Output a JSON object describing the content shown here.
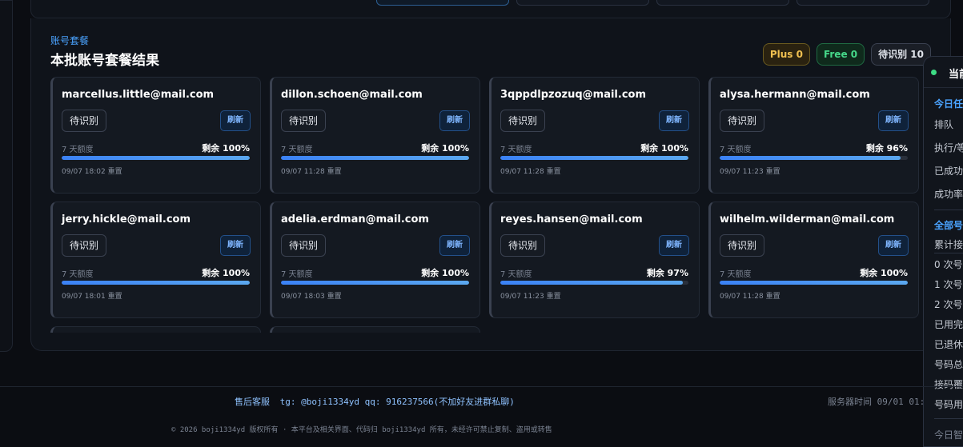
{
  "section": {
    "label": "账号套餐",
    "title": "本批账号套餐结果"
  },
  "chips": [
    {
      "key": "plus",
      "text": "Plus 0"
    },
    {
      "key": "free",
      "text": "Free 0"
    },
    {
      "key": "pending",
      "text": "待识别 10"
    }
  ],
  "accounts": [
    {
      "email": "marcellus.little@mail.com",
      "status": "待识别",
      "refresh": "刷新",
      "quota_label": "7 天额度",
      "remaining": "剩余 100%",
      "remaining_pct": 100,
      "reset": "09/07 18:02 重置"
    },
    {
      "email": "dillon.schoen@mail.com",
      "status": "待识别",
      "refresh": "刷新",
      "quota_label": "7 天额度",
      "remaining": "剩余 100%",
      "remaining_pct": 100,
      "reset": "09/07 11:28 重置"
    },
    {
      "email": "3qppdlpzozuq@mail.com",
      "status": "待识别",
      "refresh": "刷新",
      "quota_label": "7 天额度",
      "remaining": "剩余 100%",
      "remaining_pct": 100,
      "reset": "09/07 11:28 重置"
    },
    {
      "email": "alysa.hermann@mail.com",
      "status": "待识别",
      "refresh": "刷新",
      "quota_label": "7 天额度",
      "remaining": "剩余 96%",
      "remaining_pct": 96,
      "reset": "09/07 11:23 重置"
    },
    {
      "email": "jerry.hickle@mail.com",
      "status": "待识别",
      "refresh": "刷新",
      "quota_label": "7 天额度",
      "remaining": "剩余 100%",
      "remaining_pct": 100,
      "reset": "09/07 18:01 重置"
    },
    {
      "email": "adelia.erdman@mail.com",
      "status": "待识别",
      "refresh": "刷新",
      "quota_label": "7 天额度",
      "remaining": "剩余 100%",
      "remaining_pct": 100,
      "reset": "09/07 18:03 重置"
    },
    {
      "email": "reyes.hansen@mail.com",
      "status": "待识别",
      "refresh": "刷新",
      "quota_label": "7 天额度",
      "remaining": "剩余 97%",
      "remaining_pct": 97,
      "reset": "09/07 11:23 重置"
    },
    {
      "email": "wilhelm.wilderman@mail.com",
      "status": "待识别",
      "refresh": "刷新",
      "quota_label": "7 天额度",
      "remaining": "剩余 100%",
      "remaining_pct": 100,
      "reset": "09/07 11:28 重置"
    }
  ],
  "side_panel": {
    "title": "当前",
    "today_group": "今日任",
    "today_rows": [
      "排队",
      "执行/等",
      "已成功",
      "成功率"
    ],
    "all_group": "全部号",
    "all_rows": [
      "累计接",
      "0 次号码",
      "1 次号码",
      "2 次号码",
      "已用完",
      "已退休",
      "号码总",
      "接码覆",
      "号码用"
    ],
    "bottom_row": "今日智"
  },
  "footer": {
    "support_label": "售后客服",
    "support_text": "tg: @boji1334yd  qq: 916237566(不加好友进群私聊)",
    "server_time": "服务器时间 09/01 01:",
    "copyright": "© 2026 boji1334yd 版权所有 · 本平台及相关界面、代码归 boji1334yd 所有，未经许可禁止复制、盗用或转售"
  }
}
